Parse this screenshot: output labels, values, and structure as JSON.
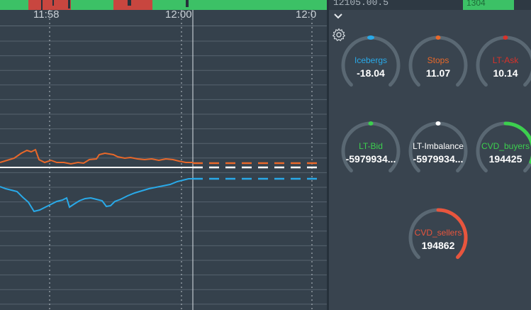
{
  "time_axis": {
    "labels": [
      "11:58",
      "12:00",
      "12:0"
    ]
  },
  "top_strip": {
    "left_value": "12105.00.5",
    "right_value": "1304"
  },
  "colors": {
    "background": "#35414c",
    "panel": "#39444f",
    "arc_track": "#5a6873",
    "blue": "#29a9e8",
    "orange": "#e8682a",
    "red": "#d8322a",
    "green": "#3ccf4e",
    "white": "#ffffff",
    "sellers": "#e8553d",
    "price_white": "#ffffff"
  },
  "gauges": [
    {
      "label": "Icebergs",
      "value": "-18.04",
      "color": "#29a9e8",
      "marker": "top",
      "fill": 0.0
    },
    {
      "label": "Stops",
      "value": "11.07",
      "color": "#e8682a",
      "marker": "top",
      "fill": 0.0
    },
    {
      "label": "LT-Ask",
      "value": "10.14",
      "color": "#d8322a",
      "marker": "top",
      "fill": 0.0
    },
    {
      "label": "LT-Bid",
      "value": "-5979934...",
      "color": "#3ccf4e",
      "marker": "top",
      "fill": 0.0
    },
    {
      "label": "LT-Imbalance",
      "value": "-5979934...",
      "color": "#ffffff",
      "marker": "top",
      "fill": 0.0
    },
    {
      "label": "CVD_buyers",
      "value": "194425",
      "color": "#3ccf4e",
      "marker": "none",
      "fill": 0.42
    },
    {
      "label": "CVD_sellers",
      "value": "194862",
      "color": "#e8553d",
      "marker": "none",
      "fill": 0.5
    }
  ],
  "icons": {
    "collapse": "chevron-down-icon",
    "settings": "gear-icon"
  }
}
